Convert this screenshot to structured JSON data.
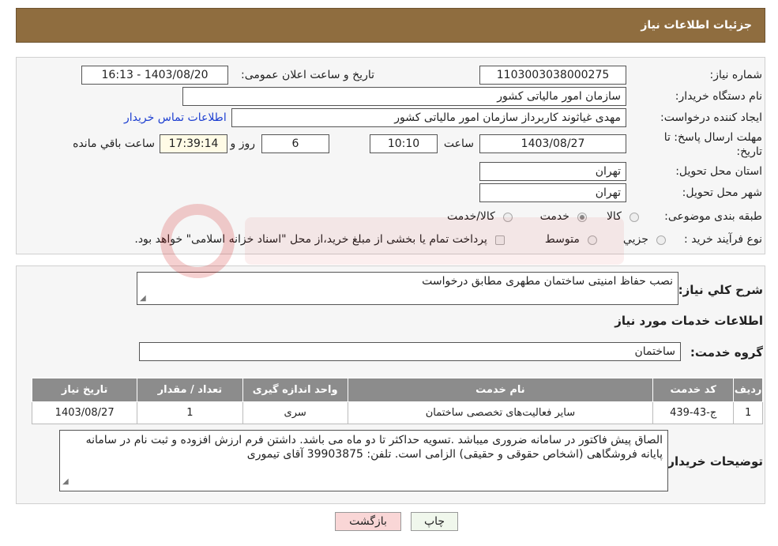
{
  "header": {
    "title": "جزئیات اطلاعات نیاز"
  },
  "form": {
    "need_number_label": "شماره نیاز:",
    "need_number": "1103003038000275",
    "announce_label": "تاریخ و ساعت اعلان عمومی:",
    "announce_value": "1403/08/20 - 16:13",
    "buyer_label": "نام دستگاه خریدار:",
    "buyer_value": "سازمان امور مالیاتی کشور",
    "creator_label": "ایجاد کننده درخواست:",
    "creator_value": "مهدی غیاثوند کاربرداز سازمان امور مالیاتی کشور",
    "contact_link": "اطلاعات تماس خریدار",
    "deadline_label_1": "مهلت ارسال پاسخ: تا",
    "deadline_label_2": "تاریخ:",
    "deadline_date": "1403/08/27",
    "time_label": "ساعت",
    "deadline_time": "10:10",
    "days_value": "6",
    "days_label": "روز و",
    "remaining_time": "17:39:14",
    "remaining_label": "ساعت باقي مانده",
    "province_label": "استان محل تحویل:",
    "province_value": "تهران",
    "city_label": "شهر محل تحویل:",
    "city_value": "تهران",
    "category_label": "طبقه بندی موضوعی:",
    "category_options": [
      "کالا",
      "خدمت",
      "کالا/خدمت"
    ],
    "category_selected": 1,
    "process_label": "نوع فرآیند خرید :",
    "process_options": [
      "جزیي",
      "متوسط"
    ],
    "process_note": "پرداخت تمام یا بخشی از مبلغ خرید،از محل \"اسناد خزانه اسلامی\" خواهد بود."
  },
  "description": {
    "label": "شرح کلي نياز:",
    "value": "نصب حفاظ امنیتی ساختمان مطهری مطابق درخواست"
  },
  "services": {
    "section_title": "اطلاعات خدمات مورد نياز",
    "group_label": "گروه خدمت:",
    "group_value": "ساختمان",
    "columns": [
      "رديف",
      "کد خدمت",
      "نام خدمت",
      "واحد اندازه گیری",
      "تعداد / مقدار",
      "تاريخ نياز"
    ],
    "rows": [
      [
        "1",
        "ج-43-439",
        "سایر فعالیت‌های تخصصی ساختمان",
        "سری",
        "1",
        "1403/08/27"
      ]
    ]
  },
  "notes": {
    "label": "توضيحات خريدار:",
    "value": "الصاق پیش فاکتور در سامانه ضروری میباشد .تسویه حداکثر تا دو ماه می باشد.  داشتن فرم ارزش افزوده و ثبت نام در سامانه پایانه فروشگاهی (اشخاص حقوقی و حقیقی) الزامی است. تلفن:  39903875 آقای تیموری"
  },
  "buttons": {
    "print": "چاپ",
    "back": "بازگشت"
  },
  "colors": {
    "header": "#8f6d3f",
    "table_head": "#8c8c8c",
    "link": "#1d3fd1",
    "back_btn": "#f9d6d6"
  }
}
